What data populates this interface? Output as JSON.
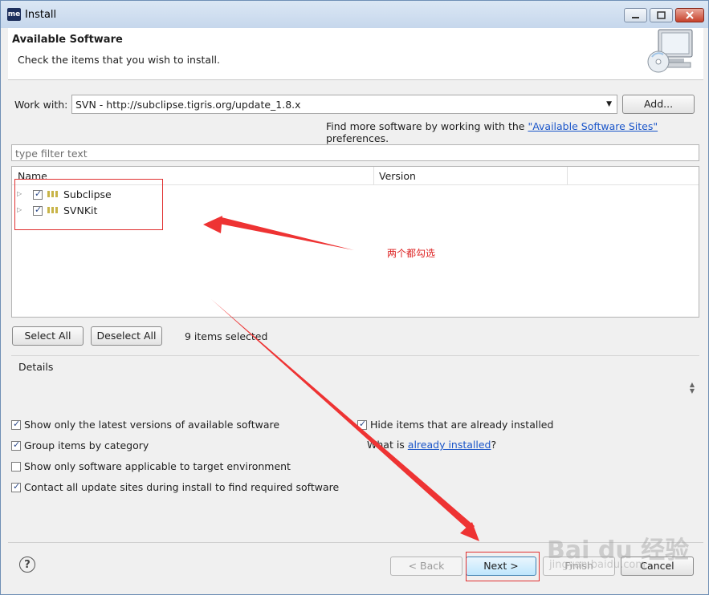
{
  "window": {
    "title": "Install",
    "app_icon_text": "me"
  },
  "header": {
    "title": "Available Software",
    "subtitle": "Check the items that you wish to install."
  },
  "work_with": {
    "label": "Work with:",
    "value": "SVN - http://subclipse.tigris.org/update_1.8.x",
    "add_button": "Add...",
    "find_more_prefix": "Find more software by working with the",
    "find_more_link": "\"Available Software Sites\"",
    "find_more_suffix": "preferences."
  },
  "filter": {
    "placeholder": "type filter text"
  },
  "tree": {
    "columns": [
      "Name",
      "Version"
    ],
    "items": [
      {
        "label": "Subclipse",
        "checked": true
      },
      {
        "label": "SVNKit",
        "checked": true
      }
    ]
  },
  "selection": {
    "select_all": "Select All",
    "deselect_all": "Deselect All",
    "status": "9 items selected"
  },
  "details": {
    "label": "Details"
  },
  "options": {
    "latest_versions": "Show only the latest versions of available software",
    "group_by_category": "Group items by category",
    "applicable_only": "Show only software applicable to target environment",
    "contact_sites": "Contact all update sites during install to find required software",
    "hide_installed": "Hide items that are already installed",
    "what_is_prefix": "What is",
    "what_is_link": "already installed",
    "what_is_suffix": "?"
  },
  "footer": {
    "help": "?",
    "back": "< Back",
    "next": "Next >",
    "finish": "Finish",
    "cancel": "Cancel"
  },
  "annotation": {
    "note": "两个都勾选",
    "color": "#e03030"
  },
  "watermark": {
    "main": "Bai du 经验",
    "sub": "jingyan.baidu.com"
  }
}
